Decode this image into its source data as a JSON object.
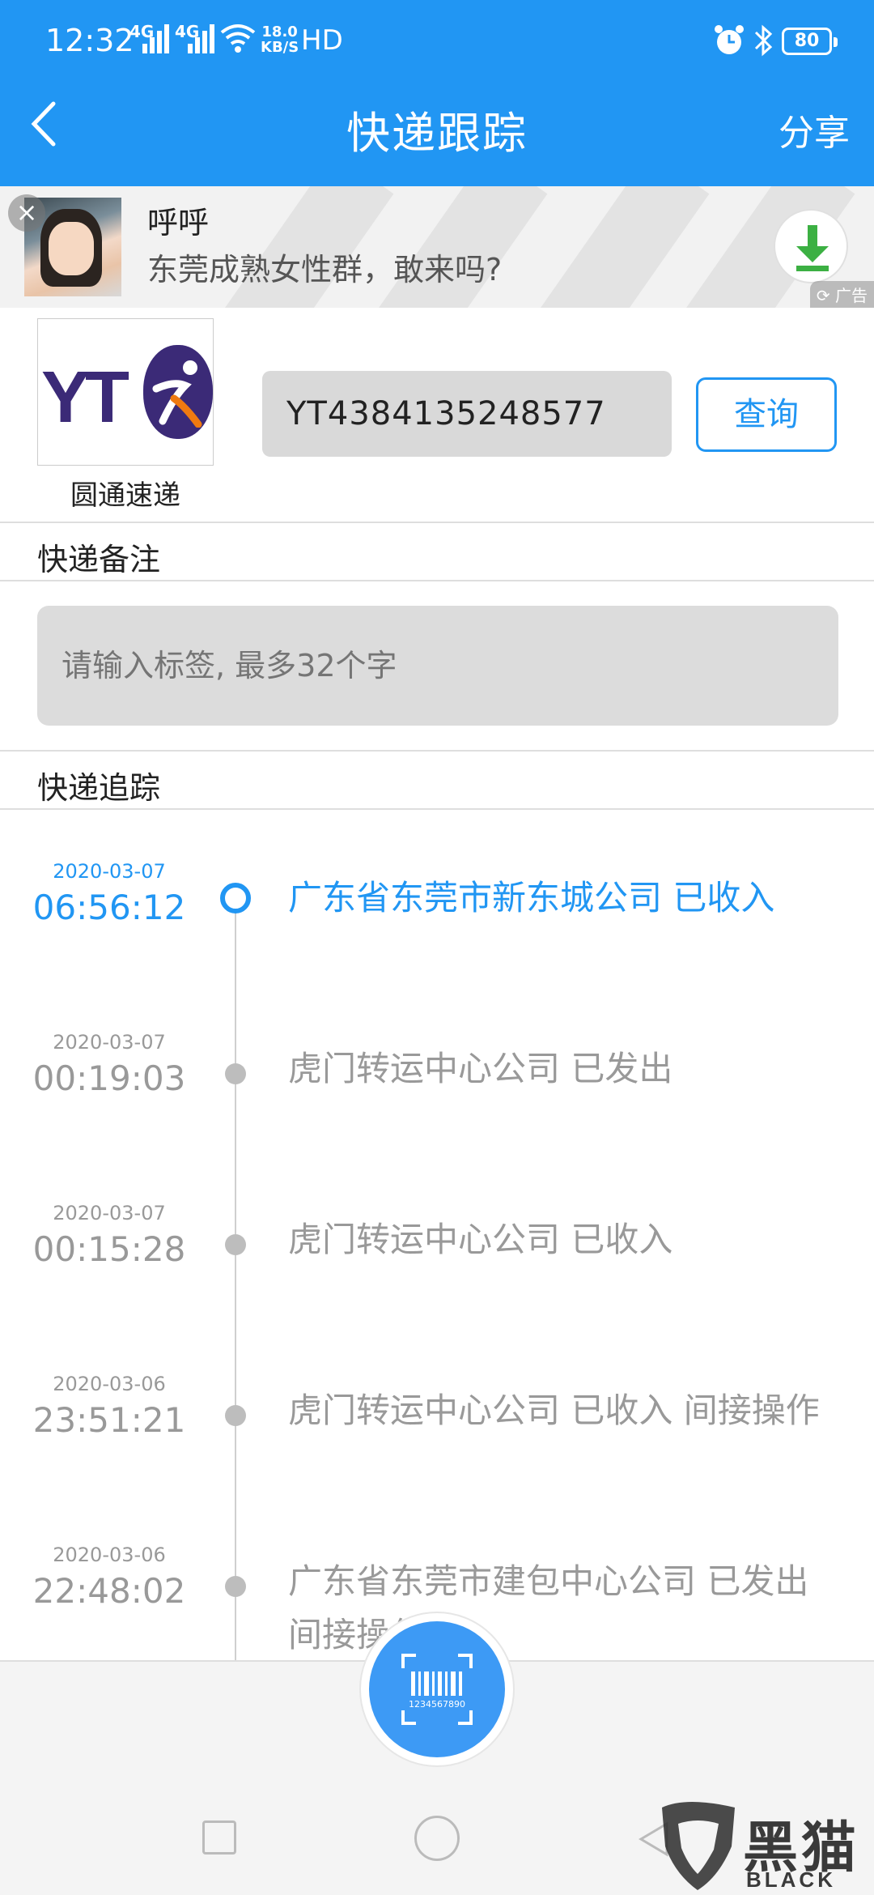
{
  "status_bar": {
    "time": "12:32",
    "network1": "4G",
    "network2": "4G",
    "speed_value": "18.0",
    "speed_unit": "KB/S",
    "hd": "HD",
    "battery": "80"
  },
  "header": {
    "title": "快递跟踪",
    "share_label": "分享"
  },
  "ad": {
    "name": "呼呼",
    "message": "东莞成熟女性群，敢来吗?",
    "ad_tag": "广告"
  },
  "courier": {
    "logo_text": "YT",
    "name": "圆通速递",
    "tracking_number": "YT4384135248577",
    "query_label": "查询"
  },
  "notes": {
    "label": "快递备注",
    "placeholder": "请输入标签, 最多32个字"
  },
  "tracking": {
    "label": "快递追踪",
    "events": [
      {
        "date": "2020-03-07",
        "time": "06:56:12",
        "text": "广东省东莞市新东城公司 已收入",
        "active": true
      },
      {
        "date": "2020-03-07",
        "time": "00:19:03",
        "text": "虎门转运中心公司 已发出",
        "active": false
      },
      {
        "date": "2020-03-07",
        "time": "00:15:28",
        "text": "虎门转运中心公司 已收入",
        "active": false
      },
      {
        "date": "2020-03-06",
        "time": "23:51:21",
        "text": "虎门转运中心公司 已收入 间接操作",
        "active": false
      },
      {
        "date": "2020-03-06",
        "time": "22:48:02",
        "text": "广东省东莞市建包中心公司 已发出 间接操作",
        "active": false
      }
    ]
  },
  "scan": {
    "barcode_number": "1234567890"
  },
  "watermark": {
    "text": "黑猫",
    "sub": "BLACK CAT"
  },
  "colors": {
    "accent": "#2196f3",
    "inactive_text": "#999999"
  }
}
